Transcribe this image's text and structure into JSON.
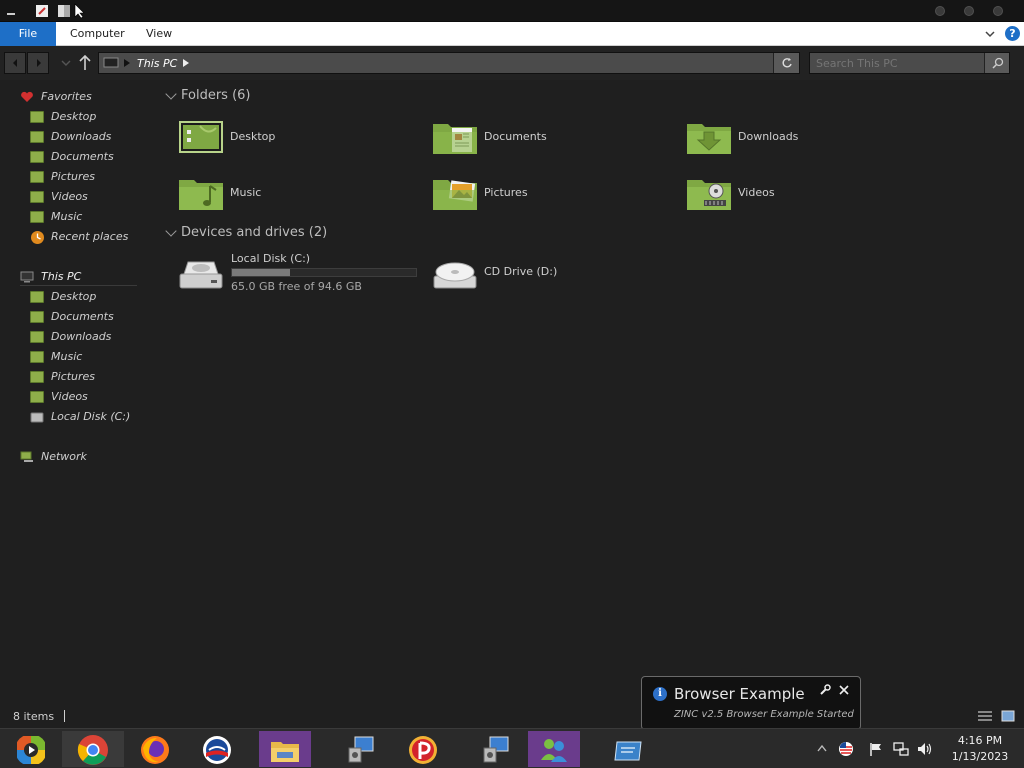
{
  "window": {
    "ribbon_tabs": [
      "File",
      "Computer",
      "View"
    ],
    "address_path": "This PC",
    "search_placeholder": "Search This PC"
  },
  "sidebar": {
    "favorites": {
      "label": "Favorites",
      "items": [
        "Desktop",
        "Downloads",
        "Documents",
        "Pictures",
        "Videos",
        "Music",
        "Recent places"
      ]
    },
    "this_pc": {
      "label": "This PC",
      "items": [
        "Desktop",
        "Documents",
        "Downloads",
        "Music",
        "Pictures",
        "Videos",
        "Local Disk (C:)"
      ]
    },
    "network": {
      "label": "Network"
    }
  },
  "content": {
    "folders_header": "Folders (6)",
    "folders": [
      "Desktop",
      "Documents",
      "Downloads",
      "Music",
      "Pictures",
      "Videos"
    ],
    "devices_header": "Devices and drives (2)",
    "drives": [
      {
        "name": "Local Disk (C:)",
        "free_text": "65.0 GB free of 94.6 GB",
        "used_fraction": 0.313
      },
      {
        "name": "CD Drive (D:)"
      }
    ]
  },
  "status": {
    "items_count": "8 items"
  },
  "notification": {
    "title": "Browser Example",
    "message": "ZINC v2.5 Browser Example Started"
  },
  "taskbar": {
    "apps": [
      "windows-media-icon",
      "chrome-icon",
      "firefox-icon",
      "obama-logo-icon",
      "file-explorer-icon",
      "network-setup-icon",
      "pinterest-app-icon",
      "network-setup-icon",
      "messenger-icon",
      "window-icon"
    ],
    "time": "4:16 PM",
    "date": "1/13/2023"
  },
  "colors": {
    "accent_blue": "#1e6fc7",
    "folder_green": "#8eae4a"
  }
}
